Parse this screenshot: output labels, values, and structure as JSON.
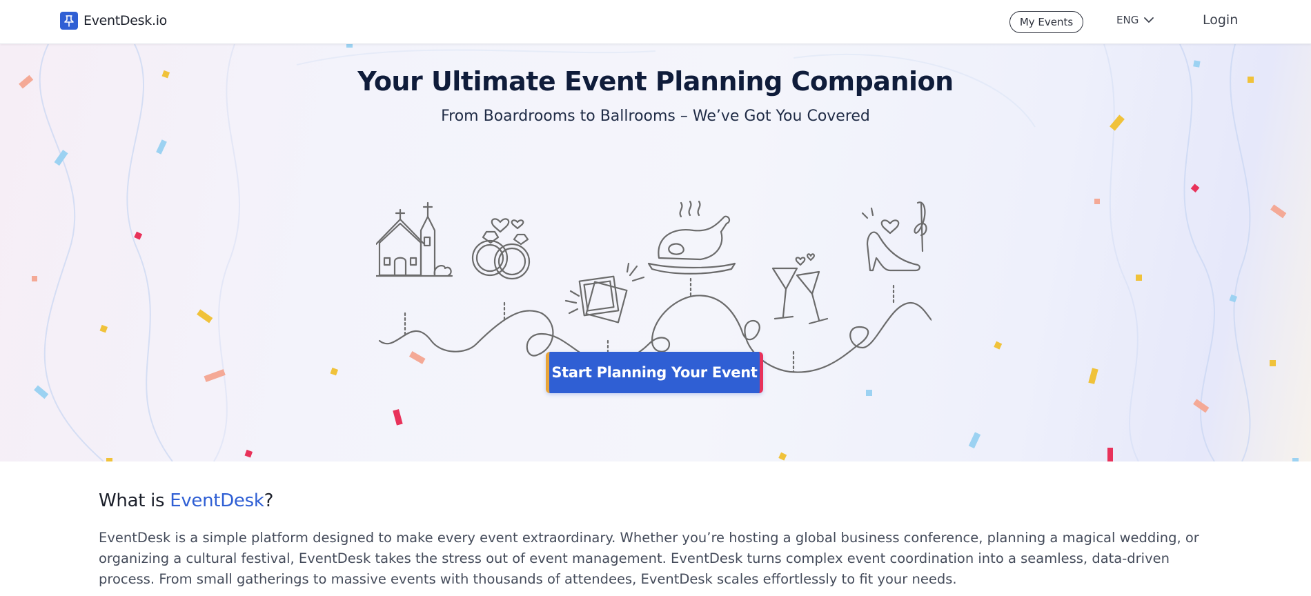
{
  "header": {
    "brand": "EventDesk.io",
    "my_events": "My Events",
    "language": "ENG",
    "login": "Login"
  },
  "hero": {
    "title": "Your Ultimate Event Planning Companion",
    "subtitle": "From Boardrooms to Ballrooms – We’ve Got You Covered",
    "cta": "Start Planning Your Event"
  },
  "about": {
    "heading_prefix": "What is ",
    "heading_brand": "EventDesk",
    "heading_suffix": "?",
    "body": "EventDesk is a simple platform designed to make every event extraordinary. Whether you’re hosting a global business conference, planning a magical wedding, or organizing a cultural festival, EventDesk takes the stress out of event management. EventDesk turns complex event coordination into a seamless, data-driven process. From small gatherings to massive events with thousands of attendees, EventDesk scales effortlessly to fit your needs."
  },
  "colors": {
    "brand_blue": "#2f5fd4",
    "cta_left_accent": "#e8a53a",
    "cta_right_accent": "#e8325a",
    "title_navy": "#0f1c3a"
  },
  "icons": [
    "pushpin-icon",
    "chevron-down-icon",
    "chapel-icon",
    "wedding-rings-icon",
    "photo-frames-icon",
    "roast-turkey-icon",
    "cocktail-glasses-icon",
    "high-heel-music-icon",
    "confetti-decoration"
  ]
}
